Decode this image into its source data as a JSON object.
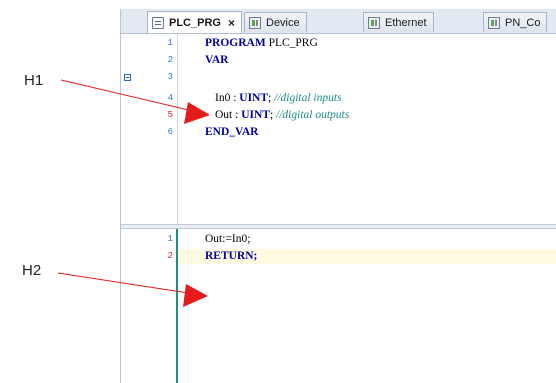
{
  "tabs": [
    {
      "label": "PLC_PRG",
      "close": "×",
      "icon": "document-icon",
      "active": true
    },
    {
      "label": "Device",
      "icon": "device-icon"
    },
    {
      "label": "Ethernet",
      "icon": "device-icon"
    },
    {
      "label": "PN_Co",
      "icon": "device-icon"
    }
  ],
  "declaration_lines": [
    {
      "n": "1",
      "a": "PROGRAM",
      "b": " PLC_PRG"
    },
    {
      "n": "2",
      "a": "VAR"
    },
    {
      "n": "3"
    },
    {
      "n": "4",
      "var": "In0 : ",
      "type": "UINT",
      "semi": "; ",
      "comment": "//digital inputs"
    },
    {
      "n": "5",
      "var": "Out : ",
      "type": "UINT",
      "semi": "; ",
      "comment": "//digital outputs"
    },
    {
      "n": "6",
      "a": "END_VAR"
    }
  ],
  "implementation_lines": [
    {
      "n": "1",
      "code": "Out:=In0;"
    },
    {
      "n": "2",
      "code": "RETURN;"
    }
  ],
  "annotations": {
    "h1": "H1",
    "h2": "H2"
  },
  "colors": {
    "keyword": "#0000a0",
    "comment": "#1e8c8c",
    "arrow": "#e31b1b",
    "line_number": "#2b7ac9",
    "error_line_number": "#cc2222"
  }
}
